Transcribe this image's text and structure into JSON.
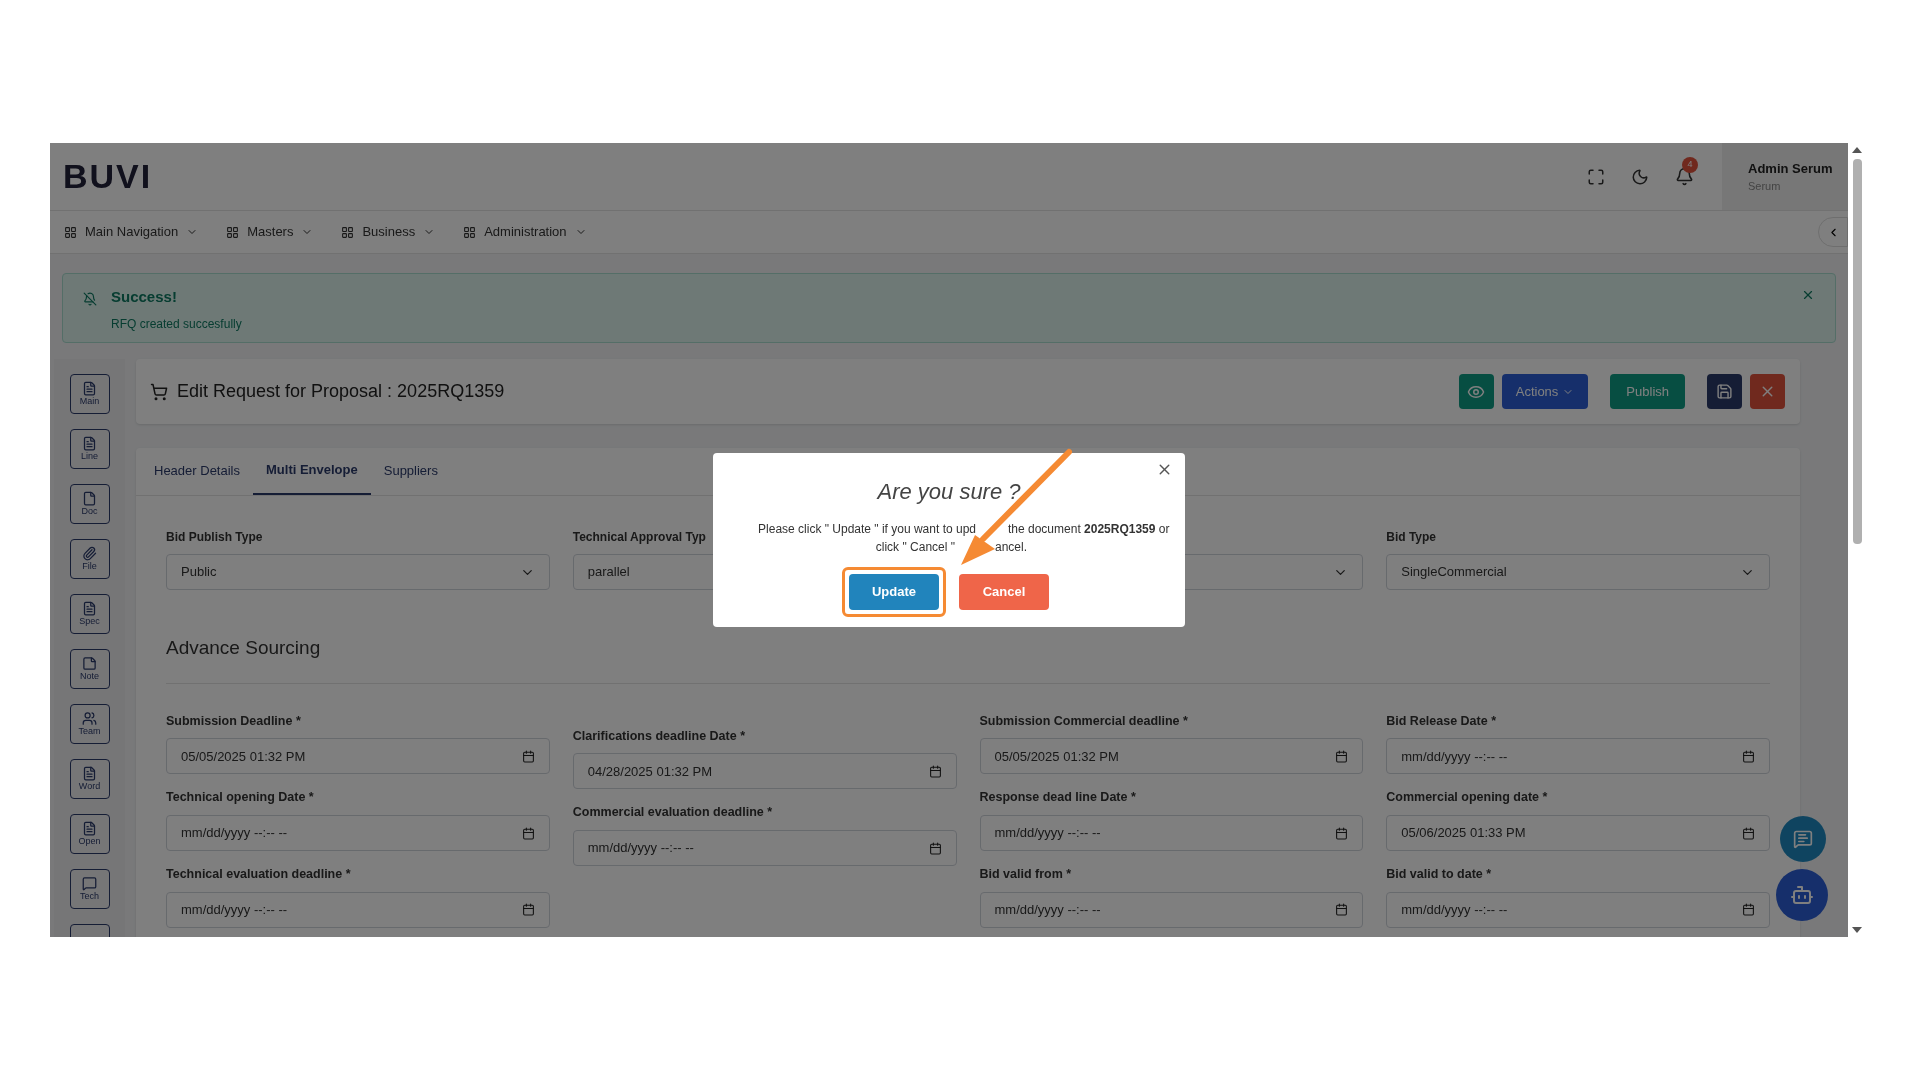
{
  "header": {
    "logo": "BUVI",
    "notification_count": "4",
    "user_name": "Admin Serum",
    "user_role": "Serum"
  },
  "nav": [
    {
      "label": "Main Navigation"
    },
    {
      "label": "Masters"
    },
    {
      "label": "Business"
    },
    {
      "label": "Administration"
    }
  ],
  "alert": {
    "title": "Success!",
    "message": "RFQ created succesfully"
  },
  "sidebar": [
    {
      "label": "Main",
      "kind": "doc"
    },
    {
      "label": "Line",
      "kind": "doc"
    },
    {
      "label": "Doc",
      "kind": "page"
    },
    {
      "label": "File",
      "kind": "clip"
    },
    {
      "label": "Spec",
      "kind": "doc"
    },
    {
      "label": "Note",
      "kind": "note"
    },
    {
      "label": "Team",
      "kind": "team"
    },
    {
      "label": "Word",
      "kind": "doc"
    },
    {
      "label": "Open",
      "kind": "doc"
    },
    {
      "label": "Tech",
      "kind": "chat"
    },
    {
      "kind": "stub"
    }
  ],
  "page": {
    "title": "Edit Request for Proposal : 2025RQ1359",
    "actions": [
      {
        "kind": "view"
      },
      {
        "kind": "menu",
        "label": "Actions"
      },
      {
        "kind": "publish",
        "label": "Publish"
      },
      {
        "kind": "save"
      },
      {
        "kind": "close"
      }
    ]
  },
  "tabs": [
    {
      "label": "Header Details",
      "selected": false
    },
    {
      "label": "Multi Envelope",
      "selected": true
    },
    {
      "label": "Suppliers",
      "selected": false
    }
  ],
  "top_fields": [
    {
      "kind": "select",
      "label": "Bid Publish Type",
      "value": "Public"
    },
    {
      "kind": "select_cut",
      "label": "Technical Approval Typ",
      "value": "parallel"
    },
    {
      "kind": "select"
    },
    {
      "kind": "select",
      "label": "Bid Type",
      "value": "SingleCommercial"
    }
  ],
  "section_title": "Advance Sourcing",
  "date_columns": [
    [
      {
        "label": "Submission Deadline *",
        "value": "05/05/2025 01:32 PM"
      },
      {
        "label": "Technical opening Date *",
        "placeholder": "mm/dd/yyyy --:-- --"
      },
      {
        "label": "Technical evaluation deadline *",
        "placeholder": "mm/dd/yyyy --:-- --"
      }
    ],
    [
      {
        "label": "Clarifications deadline Date *",
        "value": "04/28/2025 01:32 PM"
      },
      {
        "label": "Commercial evaluation deadline *",
        "placeholder": "mm/dd/yyyy --:-- --"
      }
    ],
    [
      {
        "label": "Submission Commercial deadline *",
        "value": "05/05/2025 01:32 PM"
      },
      {
        "label": "Response dead line Date *",
        "placeholder": "mm/dd/yyyy --:-- --"
      },
      {
        "label": "Bid valid from *",
        "placeholder": "mm/dd/yyyy --:-- --"
      }
    ],
    [
      {
        "label": "Bid Release Date *",
        "placeholder": "mm/dd/yyyy --:-- --"
      },
      {
        "label": "Commercial opening date *",
        "value": "05/06/2025 01:33 PM"
      },
      {
        "label": "Bid valid to date *",
        "placeholder": "mm/dd/yyyy --:-- --"
      }
    ]
  ],
  "dialog": {
    "title": "Are you sure ?",
    "message_lines": [
      [
        "Please click \" Update \" if you want to upd",
        "the document **2025RQ1359** or"
      ],
      [
        "click \" Cancel \"",
        "ancel."
      ]
    ],
    "buttons": [
      {
        "label": "Update",
        "kind": "confirm",
        "highlighted": true
      },
      {
        "label": "Cancel",
        "kind": "cancel",
        "highlighted": false
      }
    ]
  }
}
